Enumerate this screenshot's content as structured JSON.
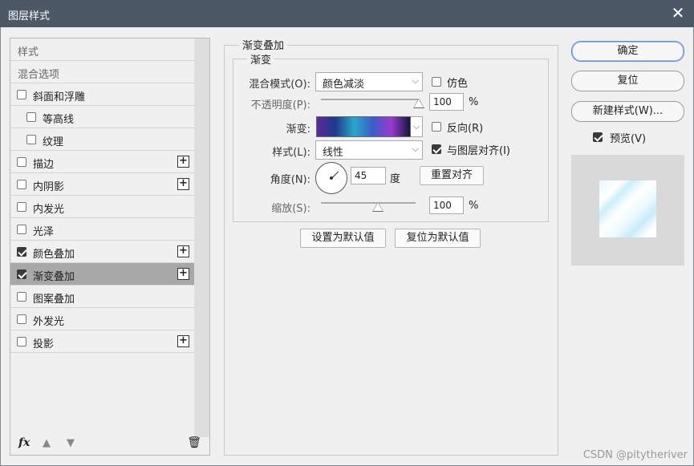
{
  "window": {
    "title": "图层样式",
    "close_label": "✕"
  },
  "left_panel": {
    "items": [
      {
        "label": "样式",
        "checkbox": false,
        "checked": false,
        "plus": false,
        "indent": 0
      },
      {
        "label": "混合选项",
        "checkbox": false,
        "checked": false,
        "plus": false,
        "indent": 0
      },
      {
        "label": "斜面和浮雕",
        "checkbox": true,
        "checked": false,
        "plus": false,
        "indent": 0
      },
      {
        "label": "等高线",
        "checkbox": true,
        "checked": false,
        "plus": false,
        "indent": 1
      },
      {
        "label": "纹理",
        "checkbox": true,
        "checked": false,
        "plus": false,
        "indent": 1
      },
      {
        "label": "描边",
        "checkbox": true,
        "checked": false,
        "plus": true,
        "indent": 0
      },
      {
        "label": "内阴影",
        "checkbox": true,
        "checked": false,
        "plus": true,
        "indent": 0
      },
      {
        "label": "内发光",
        "checkbox": true,
        "checked": false,
        "plus": false,
        "indent": 0
      },
      {
        "label": "光泽",
        "checkbox": true,
        "checked": false,
        "plus": false,
        "indent": 0
      },
      {
        "label": "颜色叠加",
        "checkbox": true,
        "checked": true,
        "plus": true,
        "indent": 0
      },
      {
        "label": "渐变叠加",
        "checkbox": true,
        "checked": true,
        "plus": true,
        "indent": 0,
        "selected": true
      },
      {
        "label": "图案叠加",
        "checkbox": true,
        "checked": false,
        "plus": false,
        "indent": 0
      },
      {
        "label": "外发光",
        "checkbox": true,
        "checked": false,
        "plus": false,
        "indent": 0
      },
      {
        "label": "投影",
        "checkbox": true,
        "checked": false,
        "plus": true,
        "indent": 0
      }
    ],
    "bottom": {
      "fx_label": "fx",
      "up_icon": "arrow-up-icon",
      "down_icon": "arrow-down-icon",
      "trash_icon": "trash-icon"
    }
  },
  "main": {
    "section_title": "渐变叠加",
    "group_title": "渐变",
    "blend_mode": {
      "label": "混合模式(O):",
      "value": "颜色减淡"
    },
    "dither": {
      "label": "仿色",
      "checked": false
    },
    "opacity": {
      "label": "不透明度(P):",
      "value": "100",
      "unit": "%",
      "fraction": 1.0
    },
    "gradient": {
      "label": "渐变:",
      "colors": [
        "#5a2a9a",
        "#1e3a8a",
        "#2aa8c8",
        "#3b5cc8",
        "#9a3ad0",
        "#101840"
      ]
    },
    "reverse": {
      "label": "反向(R)",
      "checked": false
    },
    "style": {
      "label": "样式(L):",
      "value": "线性"
    },
    "align_layer": {
      "label": "与图层对齐(I)",
      "checked": true
    },
    "angle": {
      "label": "角度(N):",
      "value": "45",
      "unit": "度"
    },
    "reset_align_button": "重置对齐",
    "scale": {
      "label": "缩放(S):",
      "value": "100",
      "unit": "%",
      "fraction": 0.6
    },
    "set_default_button": "设置为默认值",
    "reset_default_button": "复位为默认值"
  },
  "right_panel": {
    "ok_button": "确定",
    "reset_button": "复位",
    "new_style_button": "新建样式(W)...",
    "preview": {
      "label": "预览(V)",
      "checked": true
    }
  },
  "watermark": "CSDN @pitytheriver"
}
